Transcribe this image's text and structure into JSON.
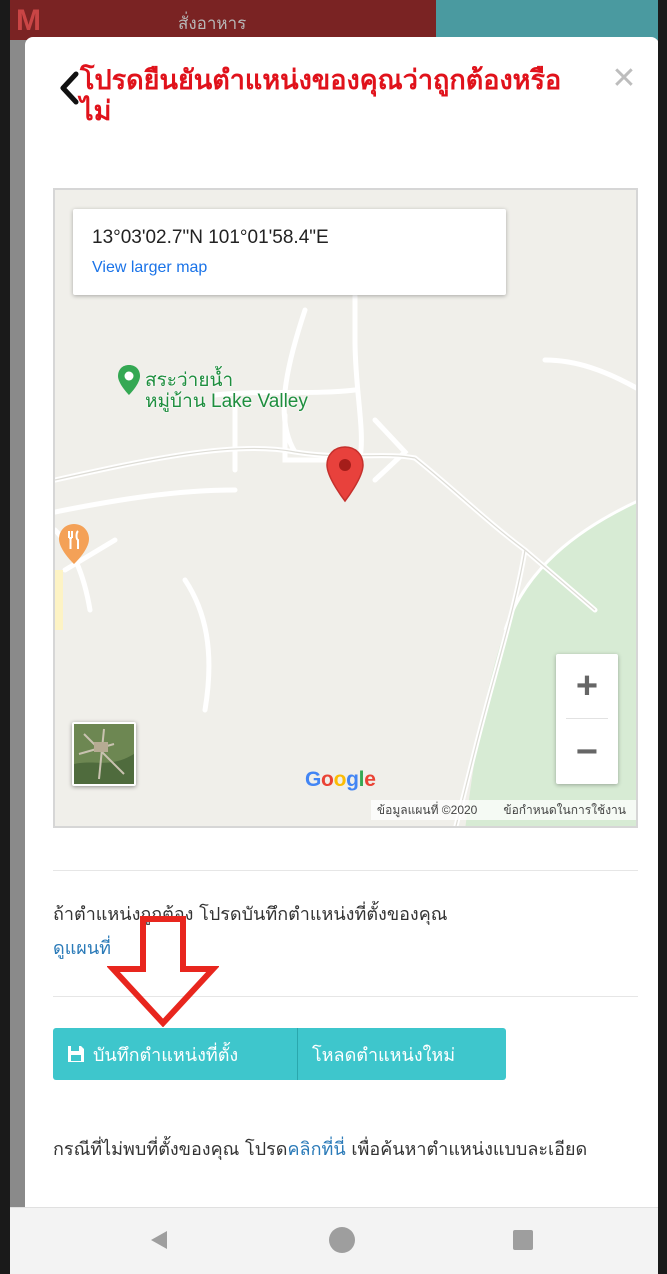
{
  "background_app": {
    "menu_label": "สั่งอาหาร"
  },
  "modal": {
    "title": "โปรดยืนยันตำแหน่งของคุณว่าถูกต้องหรือไม่",
    "close_symbol": "✕"
  },
  "map": {
    "coordinates": "13°03'02.7\"N 101°01'58.4\"E",
    "larger_map_link": "View larger map",
    "poi_label_line1": "สระว่ายน้ำ",
    "poi_label_line2": "หมู่บ้าน Lake Valley",
    "zoom_in": "+",
    "zoom_out": "−",
    "google_logo": [
      "G",
      "o",
      "o",
      "g",
      "l",
      "e"
    ],
    "google_colors": [
      "#4285f4",
      "#ea4335",
      "#fbbc05",
      "#4285f4",
      "#34a853",
      "#ea4335"
    ],
    "map_data": "ข้อมูลแผนที่ ©2020",
    "terms": "ข้อกำหนดในการใช้งาน",
    "colors": {
      "pin": "#e8413c",
      "poi": "#34a853",
      "park": "#d7ebd4",
      "land": "#f0efea"
    }
  },
  "content": {
    "hint": "ถ้าตำแหน่งถูกต้อง โปรดบันทึกตำแหน่งที่ตั้งของคุณ",
    "view_map": "ดูแผนที่",
    "save_button": "บันทึกตำแหน่งที่ตั้ง",
    "reload_button": "โหลดตำแหน่งใหม่",
    "footer_prefix": "กรณีที่ไม่พบที่ตั้งของคุณ โปรด",
    "footer_link": "คลิกที่นี่",
    "footer_suffix": " เพื่อค้นหาตำแหน่งแบบละเอียด"
  },
  "accent_colors": {
    "button": "#3ec6cc",
    "title": "#e0121b",
    "link": "#2a7ab8",
    "annotation_arrow": "#e8261e"
  }
}
